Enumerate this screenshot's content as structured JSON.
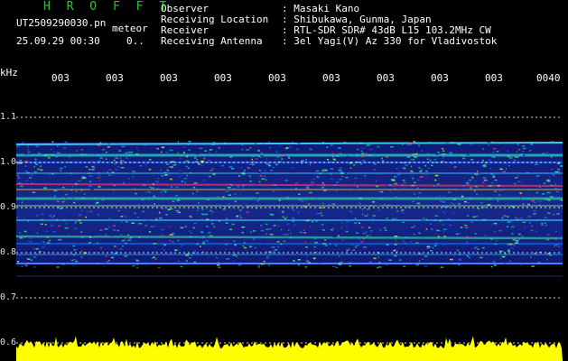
{
  "header": {
    "brand": "H R O F F T",
    "filename": "UT2509290030.pn",
    "tag": "meteor",
    "timestamp": "25.09.29 00:30",
    "counter": "0.."
  },
  "info": {
    "labels": [
      "Observer",
      "Receiving Location",
      "Receiver",
      "Receiving Antenna"
    ],
    "values": [
      ": Masaki Kano",
      ": Shibukawa, Gunma, Japan",
      ": RTL-SDR SDR# 43dB L15 103.2MHz CW",
      ": 3el Yagi(V) Az 330 for Vladivostok"
    ]
  },
  "axis": {
    "unit": "kHz",
    "time_ticks": [
      "003",
      "003",
      "003",
      "003",
      "003",
      "003",
      "003",
      "003",
      "003",
      "0040"
    ],
    "freq_ticks": [
      "1.1",
      "1.0",
      "0.9",
      "0.8",
      "0.7",
      "0.6"
    ]
  },
  "colors": {
    "brand": "#1fd11f",
    "background": "#000000",
    "grid": "#ffffff",
    "noise_floor": "#ffff00",
    "signal_band": "#1e3cff"
  }
}
